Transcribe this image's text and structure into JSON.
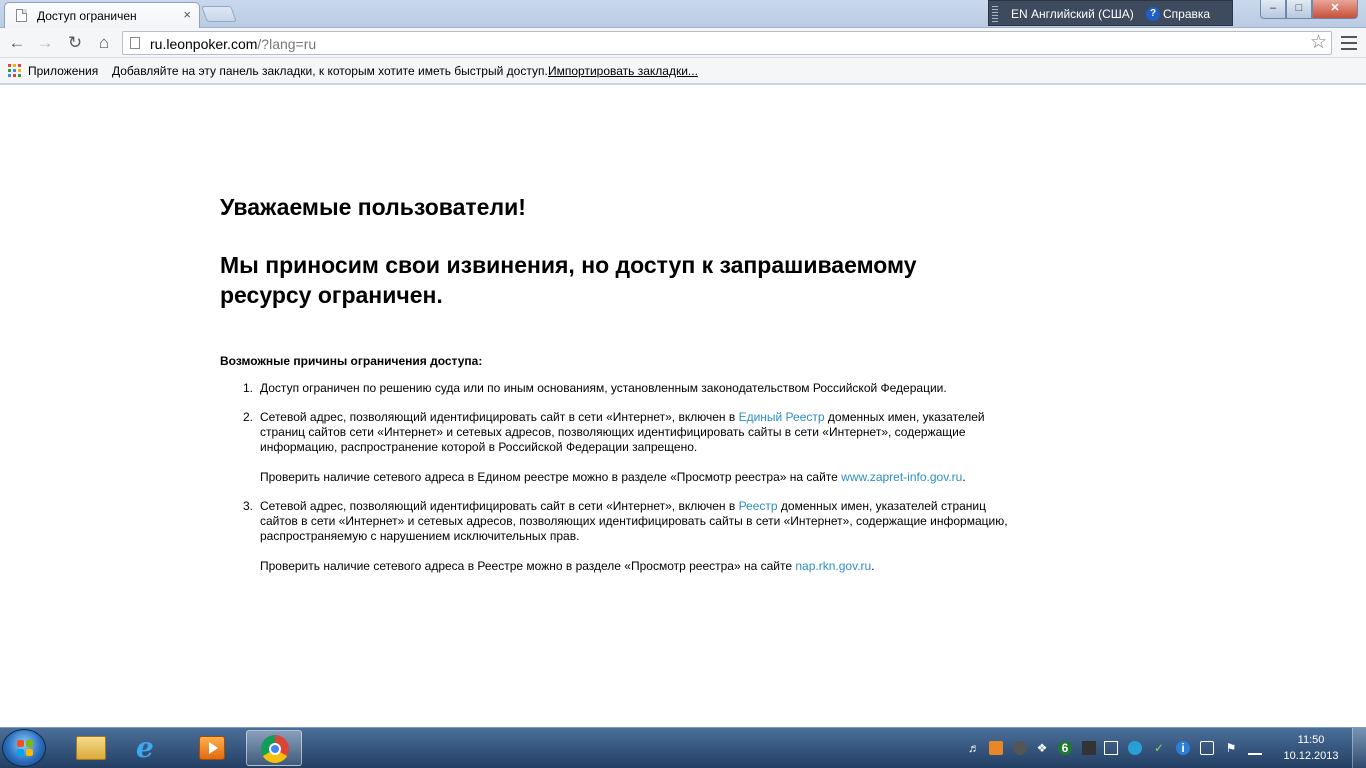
{
  "browser": {
    "tab_title": "Доступ ограничен",
    "tab_close": "×",
    "url_host": "ru.leonpoker.com",
    "url_rest": "/?lang=ru"
  },
  "language_bar": {
    "language": "EN Английский (США)",
    "help_glyph": "?",
    "help": "Справка"
  },
  "window_controls": {
    "minimize": "–",
    "maximize": "□",
    "close": "✕"
  },
  "toolbar_icons": {
    "back": "back-arrow-icon",
    "forward": "forward-arrow-icon",
    "reload": "reload-icon",
    "home": "home-icon",
    "star": "star-icon",
    "menu": "menu-icon"
  },
  "bookmarks": {
    "apps": "Приложения",
    "hint": "Добавляйте на эту панель закладки, к которым хотите иметь быстрый доступ.",
    "import": "Импортировать закладки..."
  },
  "page": {
    "greeting": "Уважаемые пользователи!",
    "apology": "Мы приносим свои извинения, но доступ к запрашиваемому ресурсу ограничен.",
    "reasons_title": "Возможные причины ограничения доступа:",
    "reasons": [
      {
        "num": "1.",
        "text": "Доступ ограничен  по решению суда или по иным основаниям, установленным законодательством Российской Федерации."
      },
      {
        "num": "2.",
        "text_before": "Сетевой адрес, позволяющий идентифицировать сайт в сети «Интернет», включен в ",
        "link": "Единый Реестр",
        "text_after": " доменных имен, указателей страниц сайтов сети «Интернет» и сетевых адресов, позволяющих идентифицировать сайты в сети «Интернет», содержащие информацию, распространение которой в Российской Федерации запрещено.",
        "check_before": "Проверить наличие сетевого адреса в Едином реестре можно в разделе «Просмотр реестра» на сайте ",
        "check_link": "www.zapret-info.gov.ru",
        "check_after": "."
      },
      {
        "num": "3.",
        "text_before": "Сетевой адрес, позволяющий идентифицировать сайт в сети «Интернет», включен в ",
        "link": "Реестр",
        "text_after": " доменных имен, указателей страниц сайтов в сети «Интернет» и сетевых адресов, позволяющих идентифицировать сайты в сети «Интернет», содержащие информацию, распространяемую с нарушением исключительных прав.",
        "check_before": "Проверить наличие сетевого адреса в Реестре можно в разделе «Просмотр реестра» на сайте ",
        "check_link": "nap.rkn.gov.ru",
        "check_after": "."
      }
    ]
  },
  "taskbar": {
    "clock_time": "11:50",
    "clock_date": "10.12.2013",
    "ie_glyph": "e",
    "tray_badge": "6"
  },
  "colors": {
    "link": "#2b8fc4",
    "chrome_red": "#db4437",
    "chrome_yellow": "#f4c20d",
    "chrome_green": "#0f9d58",
    "chrome_blue": "#4285f4"
  }
}
